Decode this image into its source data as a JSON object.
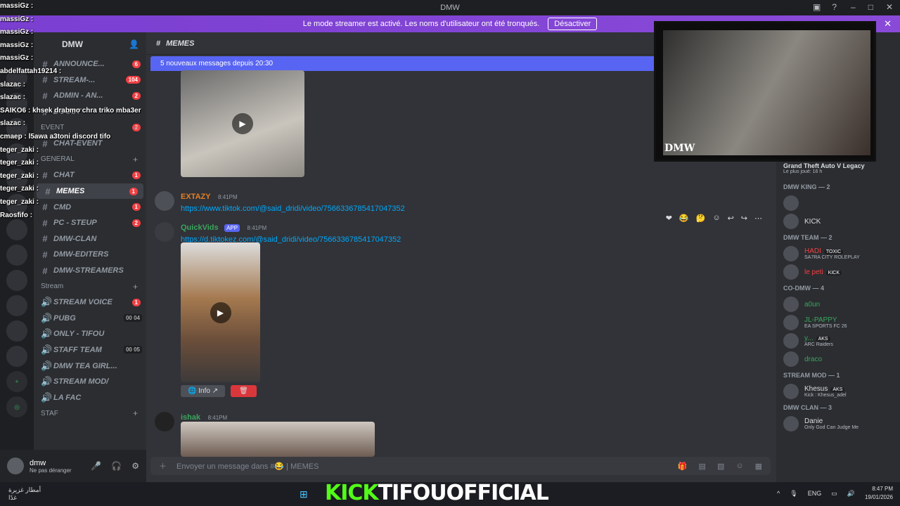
{
  "titlebar": {
    "title": "DMW"
  },
  "banner": {
    "text": "Le mode streamer est activé. Les noms d'utilisateur ont été tronqués.",
    "button": "Désactiver"
  },
  "server": {
    "name": "DMW"
  },
  "channels": [
    {
      "label": "ANNOUNCE...",
      "badge": "6",
      "kind": "text"
    },
    {
      "label": "STREAM-...",
      "badge": "104",
      "kind": "text"
    },
    {
      "label": "ADMIN - AN...",
      "badge": "2",
      "kind": "text"
    },
    {
      "label": "BOOST",
      "badge": "",
      "kind": "text"
    },
    {
      "label": "EVENT",
      "badge": "2",
      "kind": "cat"
    },
    {
      "label": "CHAT-EVENT",
      "badge": "",
      "kind": "text"
    },
    {
      "label": "GENERAL",
      "badge": "",
      "kind": "cat"
    },
    {
      "label": "CHAT",
      "badge": "1",
      "kind": "text"
    },
    {
      "label": "MEMES",
      "badge": "1",
      "kind": "active"
    },
    {
      "label": "CMD",
      "badge": "1",
      "kind": "text"
    },
    {
      "label": "PC - STEUP",
      "badge": "2",
      "kind": "text"
    },
    {
      "label": "DMW-CLAN",
      "badge": "",
      "kind": "text"
    },
    {
      "label": "DMW-EDITERS",
      "badge": "",
      "kind": "text"
    },
    {
      "label": "DMW-STREAMERS",
      "badge": "",
      "kind": "text"
    },
    {
      "label": "Stream",
      "badge": "",
      "kind": "cat"
    },
    {
      "label": "STREAM VOICE",
      "badge": "1",
      "kind": "voice"
    },
    {
      "label": "PUBG",
      "badge": "",
      "users": "00 04",
      "kind": "voice"
    },
    {
      "label": "ONLY - TIFOU",
      "badge": "",
      "kind": "voice"
    },
    {
      "label": "STAFF TEAM",
      "badge": "",
      "users": "00 05",
      "kind": "voice"
    },
    {
      "label": "DMW TEA GIRL...",
      "badge": "",
      "kind": "voice"
    },
    {
      "label": "STREAM MOD/",
      "badge": "",
      "kind": "voice"
    },
    {
      "label": "LA FAC",
      "badge": "",
      "kind": "voice"
    },
    {
      "label": "STAF",
      "badge": "",
      "kind": "cat"
    }
  ],
  "user": {
    "name": "dmw",
    "status": "Ne pas déranger"
  },
  "channel_header": {
    "name": "MEMES"
  },
  "new_messages": "5 nouveaux messages depuis 20:30",
  "messages": [
    {
      "author": "EXTAZY",
      "time": "8:41PM",
      "link": "https://www.tiktok.com/@said_dridi/video/7566336785417047352",
      "color": "#e67e22"
    },
    {
      "author": "QuickVids",
      "tag": "APP",
      "time": "8:41PM",
      "link": "https://d.tiktokez.com/@said_dridi/video/7566336785417047352",
      "color": "#3ba55c",
      "info": "Info"
    },
    {
      "author": "ishak",
      "time": "8:41PM",
      "color": "#3ba55c"
    }
  ],
  "composer": {
    "placeholder": "Envoyer un message dans #😂 | MEMES"
  },
  "members": {
    "game": {
      "title": "Grand Theft Auto V Legacy",
      "sub": "Le plus joué: 16 h"
    },
    "groups": [
      {
        "title": "DMW KING — 2",
        "items": [
          {
            "name": "",
            "sub": ""
          },
          {
            "name": "KICK",
            "sub": ""
          }
        ]
      },
      {
        "title": "DMW TEAM — 2",
        "items": [
          {
            "name": "HADI",
            "sub": "SA7RA CITY ROLEPLAY",
            "tag": "TOXIC"
          },
          {
            "name": "le peti",
            "sub": "",
            "tag": "KICK"
          }
        ]
      },
      {
        "title": "CO-DMW — 4",
        "items": [
          {
            "name": "a0un",
            "sub": ""
          },
          {
            "name": "JL-PAPPY",
            "sub": "EA SPORTS FC 26"
          },
          {
            "name": "y...",
            "sub": "ARC Raiders",
            "tag": "AKS"
          },
          {
            "name": "draco",
            "sub": ""
          }
        ]
      },
      {
        "title": "STREAM MOD — 1",
        "items": [
          {
            "name": "Khesus",
            "sub": "Kick : Khesus_adel",
            "tag": "AKS"
          }
        ]
      },
      {
        "title": "DMW CLAN — 3",
        "items": [
          {
            "name": "Danie",
            "sub": "Only God Can Judge Me"
          }
        ]
      }
    ]
  },
  "webcam": {
    "label": "DMW"
  },
  "stream_chat": [
    "massiGz :",
    "massiGz :",
    "massiGz :",
    "massiGz :",
    "massiGz :",
    "abdelfattah19214 :",
    "slazac :",
    "slazac :",
    "SAIKO6 : khsek drabmo chra triko mba3er",
    "slazac :",
    "cmaep : l5awa a3toni discord tifo",
    "teger_zaki :",
    "teger_zaki :",
    "teger_zaki :",
    "teger_zaki :",
    "teger_zaki :",
    "Raosfifo :"
  ],
  "overlay": {
    "kick": "KICK",
    "handle": "TIFOUOFFICIAL"
  },
  "taskbar": {
    "weather": "أمطار غزيرة",
    "weather_sub": "غدًا",
    "lang": "ENG",
    "time": "8:47 PM",
    "date": "19/01/2026"
  }
}
